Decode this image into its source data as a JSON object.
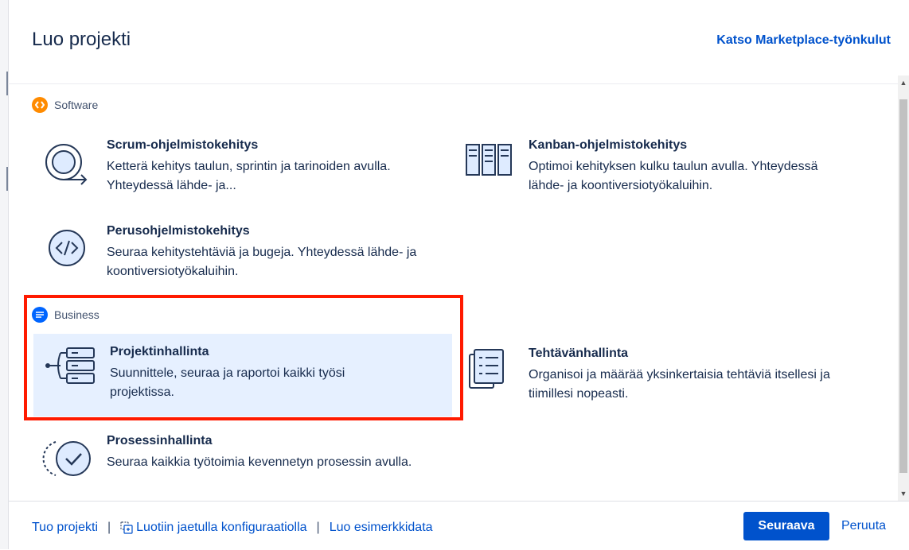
{
  "header": {
    "title": "Luo projekti",
    "marketplace_link": "Katso Marketplace-työnkulut"
  },
  "sections": {
    "software": {
      "label": "Software",
      "color": "#ff8b00",
      "templates": [
        {
          "name": "Scrum-ohjelmistokehitys",
          "description": "Ketterä kehitys taulun, sprintin ja tarinoiden avulla. Yhteydessä lähde- ja..."
        },
        {
          "name": "Kanban-ohjelmistokehitys",
          "description": "Optimoi kehityksen kulku taulun avulla. Yhteydessä lähde- ja koontiversiotyökaluihin."
        },
        {
          "name": "Perusohjelmistokehitys",
          "description": "Seuraa kehitystehtäviä ja bugeja. Yhteydessä lähde- ja koontiversiotyökaluihin."
        }
      ]
    },
    "business": {
      "label": "Business",
      "color": "#0065ff",
      "templates": [
        {
          "name": "Projektinhallinta",
          "description": "Suunnittele, seuraa ja raportoi kaikki työsi projektissa.",
          "selected": true
        },
        {
          "name": "Tehtävänhallinta",
          "description": "Organisoi ja määrää yksinkertaisia tehtäviä itsellesi ja tiimillesi nopeasti."
        },
        {
          "name": "Prosessinhallinta",
          "description": "Seuraa kaikkia työtoimia kevennetyn prosessin avulla."
        }
      ]
    }
  },
  "footer": {
    "import_link": "Tuo projekti",
    "shared_config_link": "Luotiin jaetulla konfiguraatiolla",
    "sample_data_link": "Luo esimerkkidata",
    "separator": "|",
    "next_button": "Seuraava",
    "cancel_button": "Peruuta"
  },
  "colors": {
    "primary": "#0052cc",
    "selected_bg": "#deebff",
    "highlight": "#ff1a00"
  }
}
